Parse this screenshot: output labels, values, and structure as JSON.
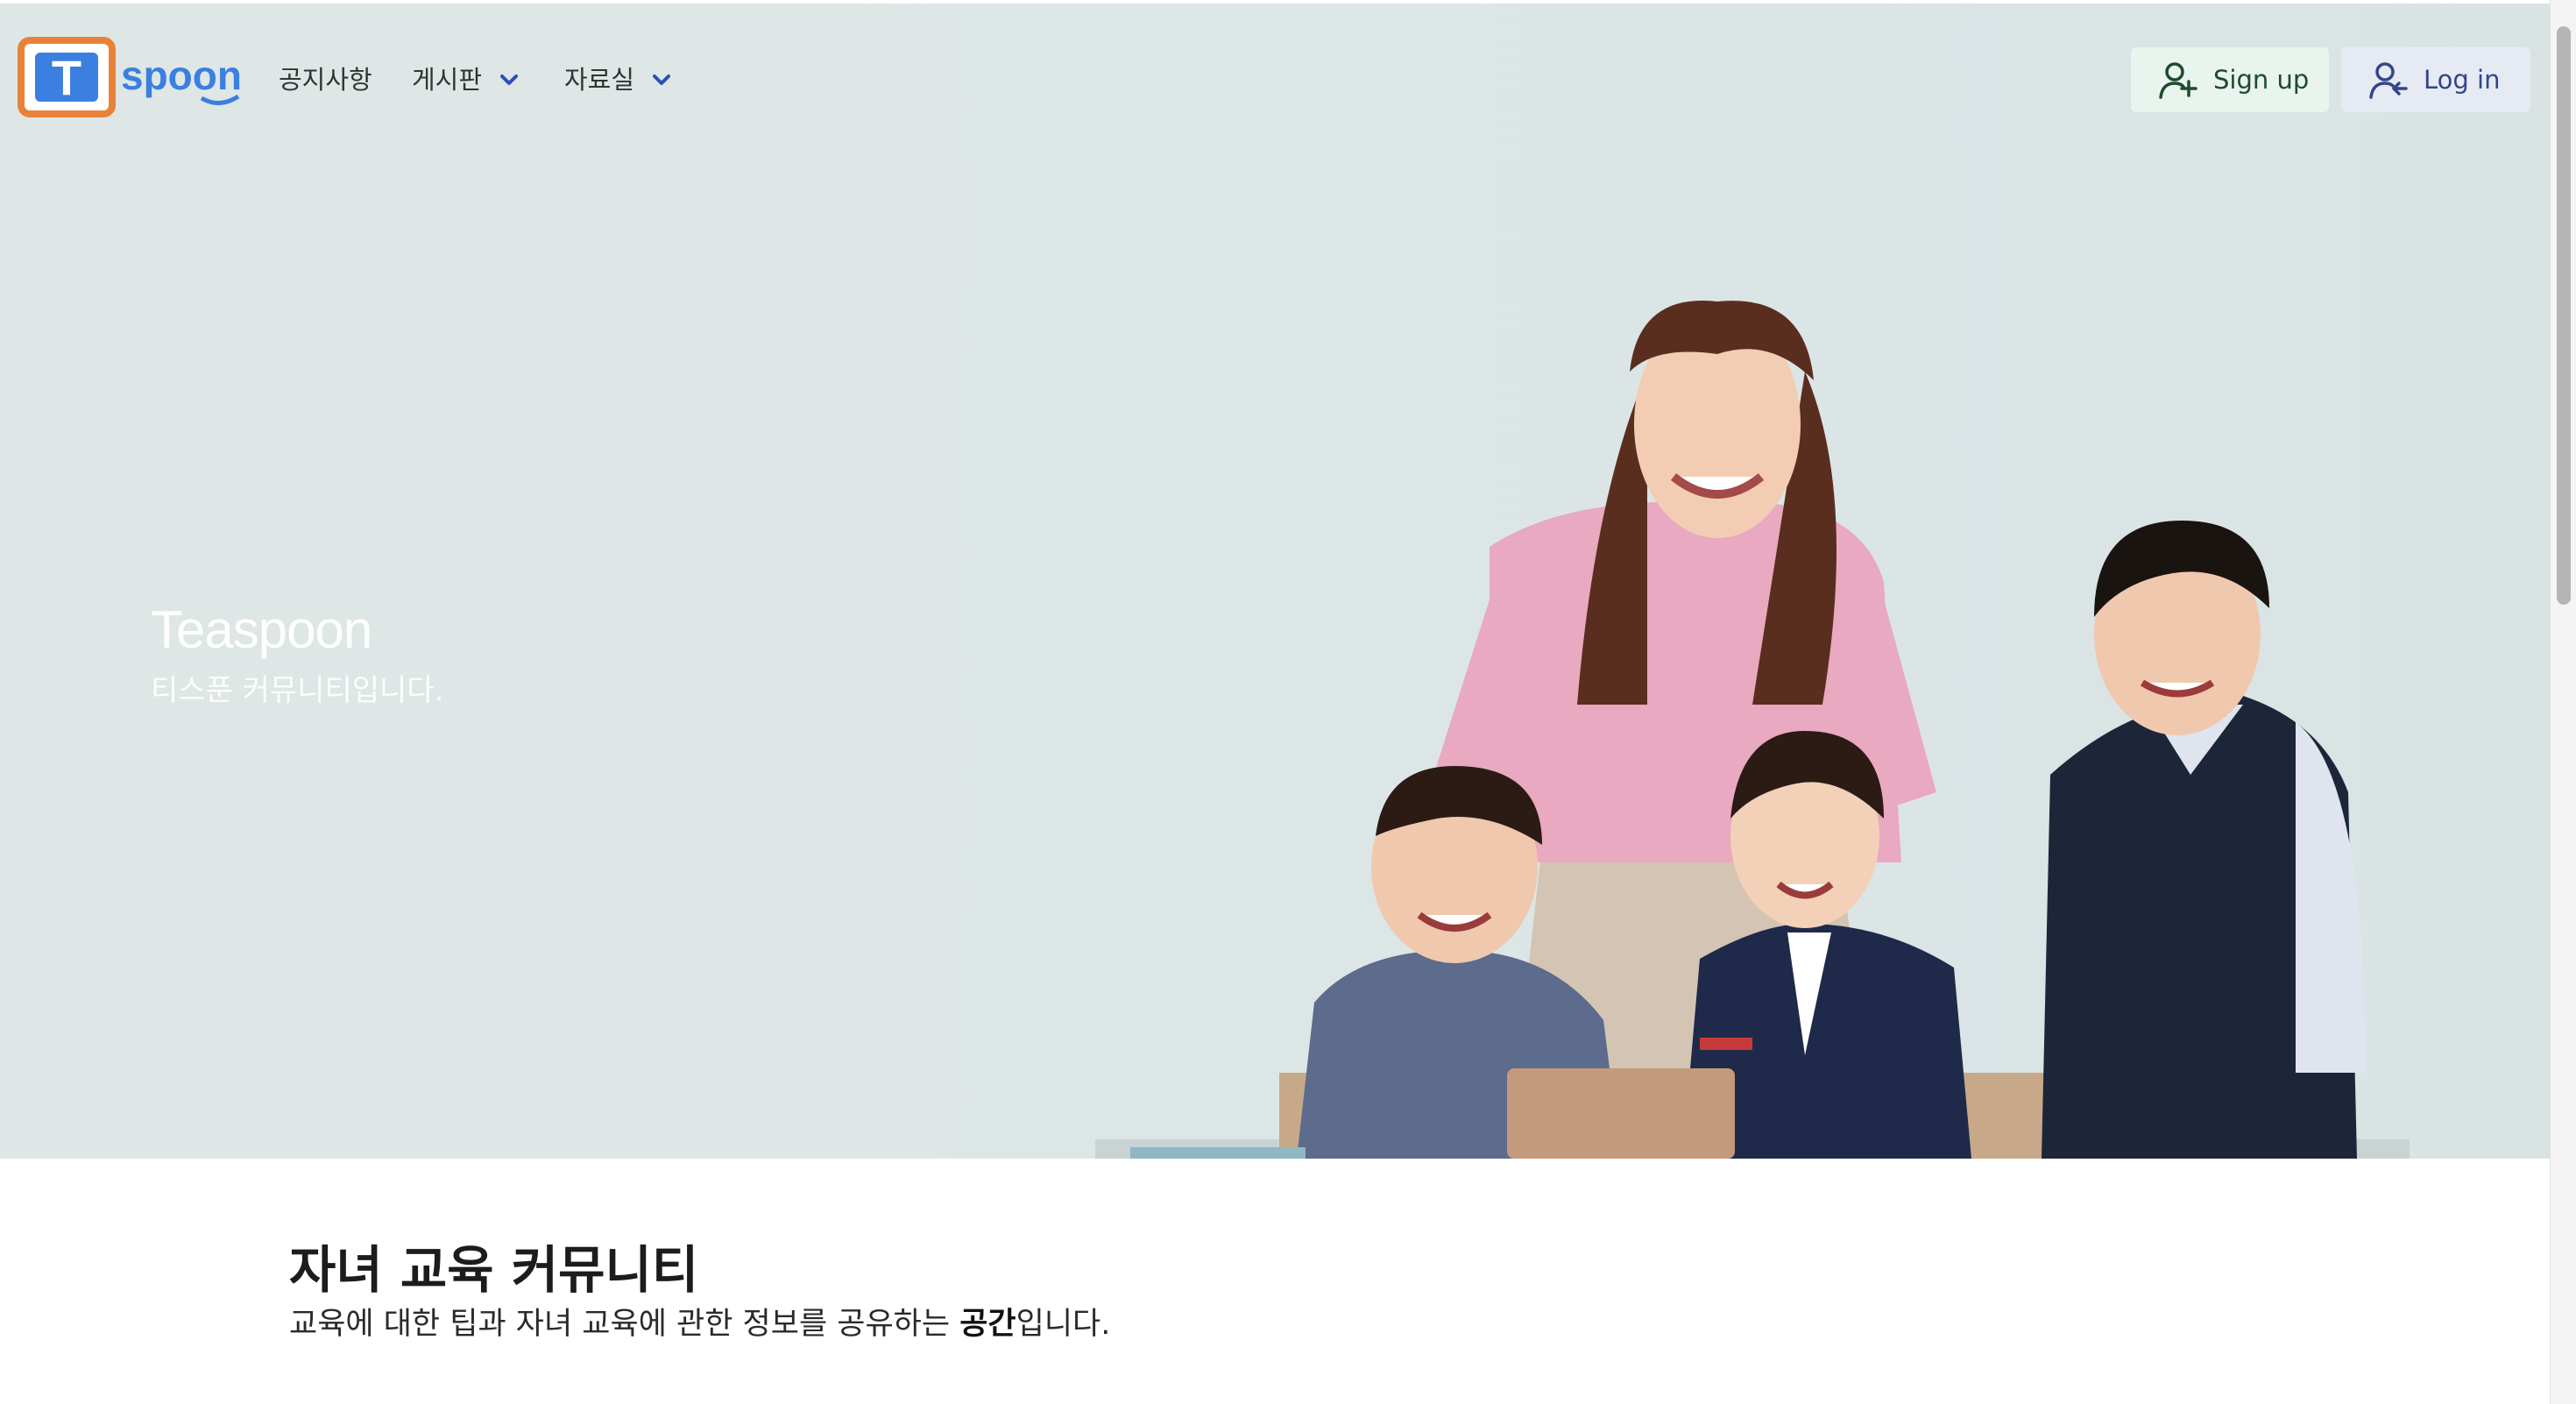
{
  "brand": {
    "logo_letter": "T",
    "logo_text": "spoon",
    "colors": {
      "logo_orange": "#e8823a",
      "logo_blue": "#3b7fe0"
    }
  },
  "nav": {
    "notice": "공지사항",
    "board": "게시판",
    "archive": "자료실",
    "dropdown_icon": "chevron-down-icon"
  },
  "auth": {
    "signup_label": "Sign up",
    "login_label": "Log in",
    "signup_icon": "person-add-icon",
    "login_icon": "person-login-icon",
    "colors": {
      "signup_bg": "#e9f4ee",
      "login_bg": "#e6ebf3"
    }
  },
  "hero": {
    "title": "Teaspoon",
    "subtitle": "티스푼 커뮤니티입니다."
  },
  "intro": {
    "heading": "자녀 교육 커뮤니티",
    "text_before": "교육에 대한 팁과 자녀 교육에 관한 정보를 공유하는 ",
    "text_bold": "공간",
    "text_after": "입니다."
  }
}
